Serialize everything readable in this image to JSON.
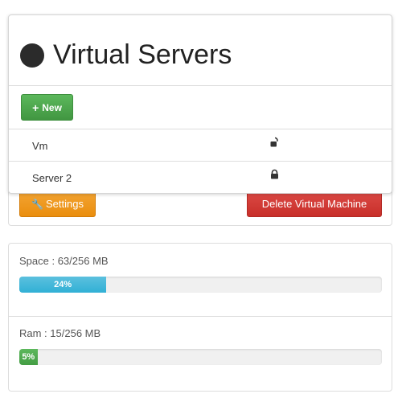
{
  "actions": {
    "settings_label": "Settings",
    "delete_label": "Delete Virtual Machine"
  },
  "servers_panel": {
    "title": "Virtual Servers",
    "new_label": "New",
    "rows": [
      {
        "name": "Vm",
        "lock_state": "unlocked",
        "icon": "unlocked-lock-icon"
      },
      {
        "name": "Server 2",
        "lock_state": "locked",
        "icon": "locked-lock-icon"
      }
    ]
  },
  "resources": {
    "space": {
      "label": "Space : 63/256 MB",
      "percent_label": "24%",
      "percent": 24
    },
    "ram": {
      "label": "Ram : 15/256 MB",
      "percent_label": "5%",
      "percent": 5
    }
  },
  "colors": {
    "new_button": "#5cb85c",
    "settings_button": "#f0ad4e",
    "delete_button": "#d9534f",
    "space_bar": "#31b0d5",
    "ram_bar": "#449d44"
  }
}
